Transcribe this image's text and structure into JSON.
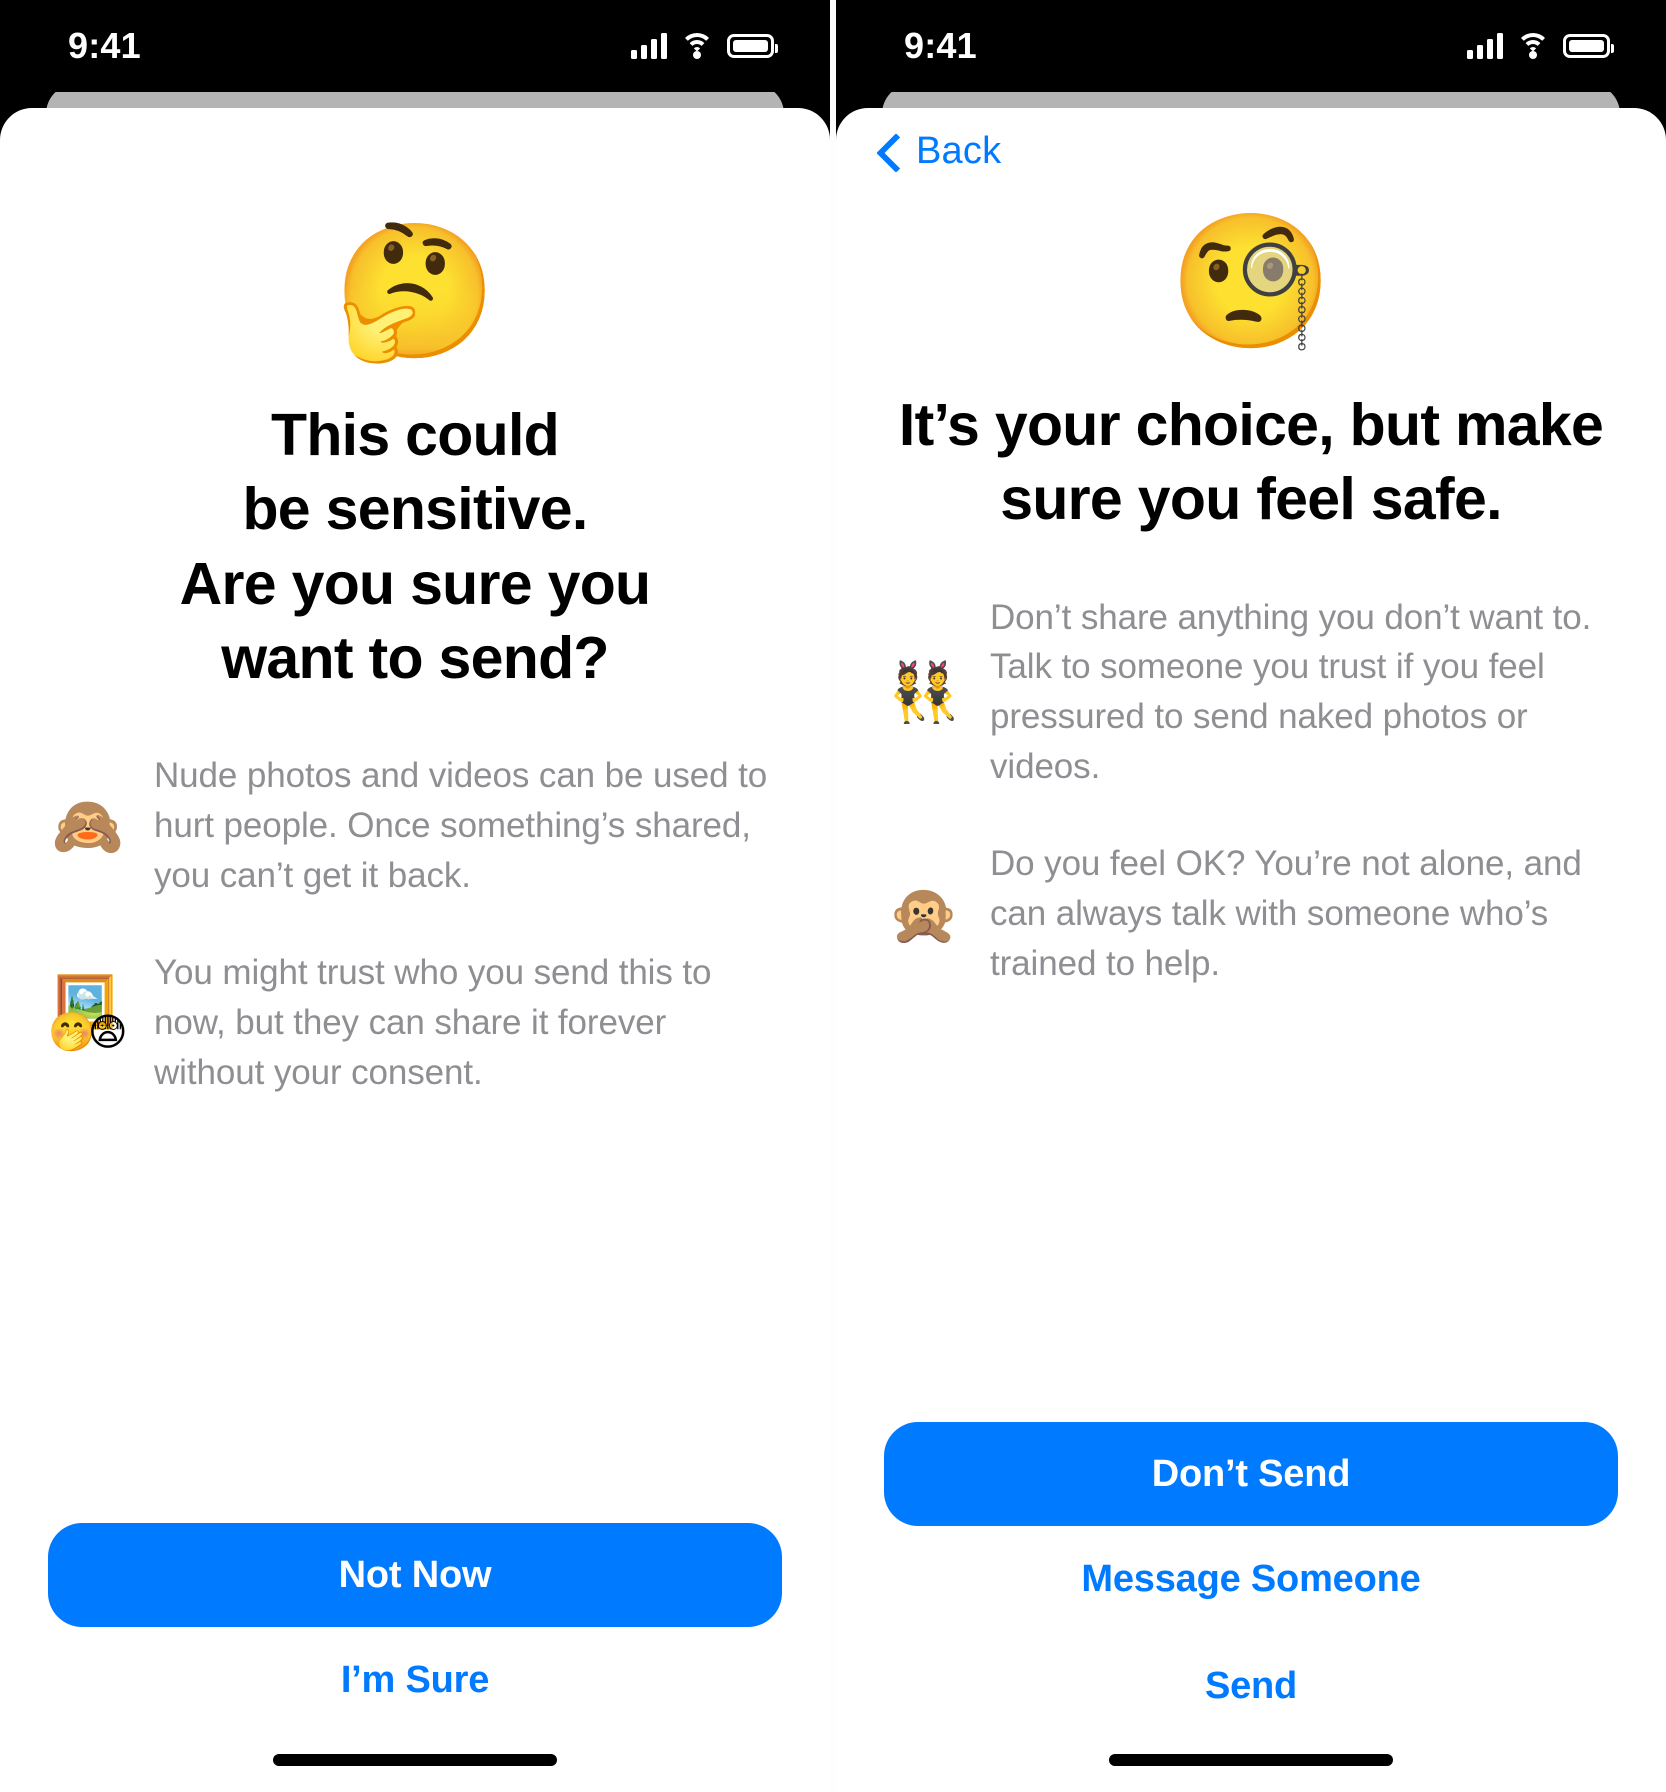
{
  "accent_blue": "#007AFF",
  "body_gray": "#8E8E93",
  "screens": [
    {
      "id": "confirm-sensitive",
      "status_bar": {
        "time": "9:41",
        "cellular_icon": "signal-bars-icon",
        "wifi_icon": "wifi-icon",
        "battery_icon": "battery-icon"
      },
      "nav": {
        "has_back": false,
        "back_label": ""
      },
      "hero": {
        "emoji": "🤔",
        "emoji_name": "thinking-face-emoji",
        "headline": "This could\nbe sensitive.\nAre you sure you\nwant to send?"
      },
      "bullets": [
        {
          "icon": "🙈",
          "icon_name": "see-no-evil-monkey-emoji",
          "text": "Nude photos and videos can be used to hurt people. Once something’s shared, you can’t get it back."
        },
        {
          "icon": "🖼️",
          "icon_name": "framed-picture-emoji",
          "icon_extra1": "🤭",
          "icon_extra2": "😨",
          "text": "You might trust who you send this to now, but they can share it forever without your consent."
        }
      ],
      "actions": [
        {
          "label": "Not Now",
          "style": "primary",
          "name": "not-now-button"
        },
        {
          "label": "I’m Sure",
          "style": "ghost",
          "name": "im-sure-button"
        }
      ]
    },
    {
      "id": "your-choice",
      "status_bar": {
        "time": "9:41",
        "cellular_icon": "signal-bars-icon",
        "wifi_icon": "wifi-icon",
        "battery_icon": "battery-icon"
      },
      "nav": {
        "has_back": true,
        "back_label": "Back"
      },
      "hero": {
        "emoji": "🧐",
        "emoji_name": "face-with-monocle-emoji",
        "headline": "It’s your choice, but make sure you feel safe."
      },
      "bullets": [
        {
          "icon": "👯",
          "icon_name": "people-with-bunny-ears-emoji",
          "text": "Don’t share anything you don’t want to. Talk to someone you trust if you feel pressured to send naked photos or videos."
        },
        {
          "icon": "🙊",
          "icon_name": "speak-no-evil-monkey-emoji",
          "text": "Do you feel OK? You’re not alone, and can always talk with someone who’s trained to help."
        }
      ],
      "actions": [
        {
          "label": "Don’t Send",
          "style": "primary",
          "name": "dont-send-button"
        },
        {
          "label": "Message Someone",
          "style": "ghost",
          "name": "message-someone-button"
        },
        {
          "label": "Send",
          "style": "ghost",
          "name": "send-button"
        }
      ]
    }
  ]
}
